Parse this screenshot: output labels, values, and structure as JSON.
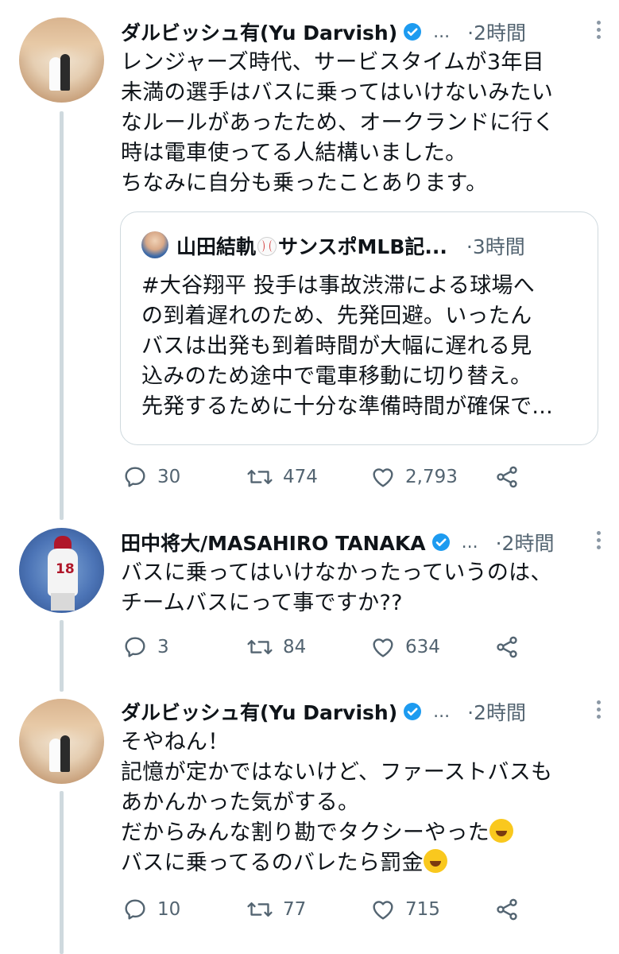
{
  "tweets": [
    {
      "name": "ダルビッシュ有(Yu Darvish)",
      "ellipsis": "...",
      "time": "·2時間",
      "lines": [
        "レンジャーズ時代、サービスタイムが3年目",
        "未満の選手はバスに乗ってはいけないみたい",
        "なルールがあったため、オークランドに行く",
        "時は電車使ってる人結構いました。",
        "ちなみに自分も乗ったことあります。"
      ],
      "quote": {
        "name_part1": "山田結軌",
        "name_part2": "サンスポMLB記...",
        "time": "·3時間",
        "lines": [
          "#大谷翔平 投手は事故渋滞による球場へ",
          "の到着遅れのため、先発回避。いったん",
          "バスは出発も到着時間が大幅に遅れる見",
          "込みのため途中で電車移動に切り替え。",
          "先発するために十分な準備時間が確保で..."
        ]
      },
      "replies": "30",
      "retweets": "474",
      "likes": "2,793"
    },
    {
      "name": "田中将大/MASAHIRO TANAKA",
      "ellipsis": "...",
      "time": "·2時間",
      "jersey_number": "18",
      "lines": [
        "バスに乗ってはいけなかったっていうのは、",
        "チームバスにって事ですか??"
      ],
      "replies": "3",
      "retweets": "84",
      "likes": "634"
    },
    {
      "name": "ダルビッシュ有(Yu Darvish)",
      "ellipsis": "...",
      "time": "·2時間",
      "lines": [
        "そやねん！",
        "記憶が定かではないけど、ファーストバスも",
        "あかんかった気がする。",
        "だからみんな割り勘でタクシーやった",
        "バスに乗ってるのバレたら罰金"
      ],
      "replies": "10",
      "retweets": "77",
      "likes": "715"
    }
  ],
  "colors": {
    "verified": "#1d9bf0",
    "muted": "#536471",
    "thread_line": "#cfd9de"
  }
}
